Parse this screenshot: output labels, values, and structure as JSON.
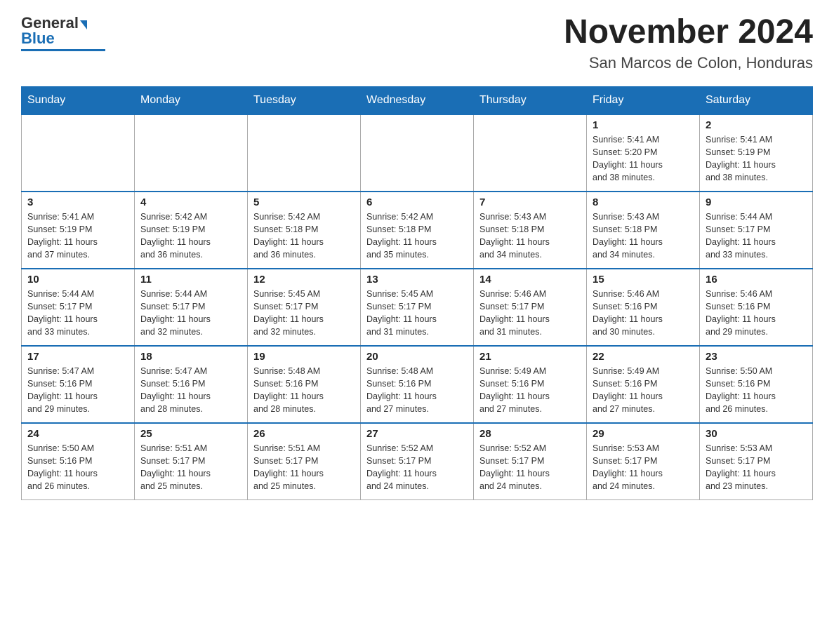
{
  "logo": {
    "general": "General",
    "blue": "Blue"
  },
  "title": "November 2024",
  "location": "San Marcos de Colon, Honduras",
  "weekdays": [
    "Sunday",
    "Monday",
    "Tuesday",
    "Wednesday",
    "Thursday",
    "Friday",
    "Saturday"
  ],
  "weeks": [
    [
      {
        "day": "",
        "info": ""
      },
      {
        "day": "",
        "info": ""
      },
      {
        "day": "",
        "info": ""
      },
      {
        "day": "",
        "info": ""
      },
      {
        "day": "",
        "info": ""
      },
      {
        "day": "1",
        "info": "Sunrise: 5:41 AM\nSunset: 5:20 PM\nDaylight: 11 hours\nand 38 minutes."
      },
      {
        "day": "2",
        "info": "Sunrise: 5:41 AM\nSunset: 5:19 PM\nDaylight: 11 hours\nand 38 minutes."
      }
    ],
    [
      {
        "day": "3",
        "info": "Sunrise: 5:41 AM\nSunset: 5:19 PM\nDaylight: 11 hours\nand 37 minutes."
      },
      {
        "day": "4",
        "info": "Sunrise: 5:42 AM\nSunset: 5:19 PM\nDaylight: 11 hours\nand 36 minutes."
      },
      {
        "day": "5",
        "info": "Sunrise: 5:42 AM\nSunset: 5:18 PM\nDaylight: 11 hours\nand 36 minutes."
      },
      {
        "day": "6",
        "info": "Sunrise: 5:42 AM\nSunset: 5:18 PM\nDaylight: 11 hours\nand 35 minutes."
      },
      {
        "day": "7",
        "info": "Sunrise: 5:43 AM\nSunset: 5:18 PM\nDaylight: 11 hours\nand 34 minutes."
      },
      {
        "day": "8",
        "info": "Sunrise: 5:43 AM\nSunset: 5:18 PM\nDaylight: 11 hours\nand 34 minutes."
      },
      {
        "day": "9",
        "info": "Sunrise: 5:44 AM\nSunset: 5:17 PM\nDaylight: 11 hours\nand 33 minutes."
      }
    ],
    [
      {
        "day": "10",
        "info": "Sunrise: 5:44 AM\nSunset: 5:17 PM\nDaylight: 11 hours\nand 33 minutes."
      },
      {
        "day": "11",
        "info": "Sunrise: 5:44 AM\nSunset: 5:17 PM\nDaylight: 11 hours\nand 32 minutes."
      },
      {
        "day": "12",
        "info": "Sunrise: 5:45 AM\nSunset: 5:17 PM\nDaylight: 11 hours\nand 32 minutes."
      },
      {
        "day": "13",
        "info": "Sunrise: 5:45 AM\nSunset: 5:17 PM\nDaylight: 11 hours\nand 31 minutes."
      },
      {
        "day": "14",
        "info": "Sunrise: 5:46 AM\nSunset: 5:17 PM\nDaylight: 11 hours\nand 31 minutes."
      },
      {
        "day": "15",
        "info": "Sunrise: 5:46 AM\nSunset: 5:16 PM\nDaylight: 11 hours\nand 30 minutes."
      },
      {
        "day": "16",
        "info": "Sunrise: 5:46 AM\nSunset: 5:16 PM\nDaylight: 11 hours\nand 29 minutes."
      }
    ],
    [
      {
        "day": "17",
        "info": "Sunrise: 5:47 AM\nSunset: 5:16 PM\nDaylight: 11 hours\nand 29 minutes."
      },
      {
        "day": "18",
        "info": "Sunrise: 5:47 AM\nSunset: 5:16 PM\nDaylight: 11 hours\nand 28 minutes."
      },
      {
        "day": "19",
        "info": "Sunrise: 5:48 AM\nSunset: 5:16 PM\nDaylight: 11 hours\nand 28 minutes."
      },
      {
        "day": "20",
        "info": "Sunrise: 5:48 AM\nSunset: 5:16 PM\nDaylight: 11 hours\nand 27 minutes."
      },
      {
        "day": "21",
        "info": "Sunrise: 5:49 AM\nSunset: 5:16 PM\nDaylight: 11 hours\nand 27 minutes."
      },
      {
        "day": "22",
        "info": "Sunrise: 5:49 AM\nSunset: 5:16 PM\nDaylight: 11 hours\nand 27 minutes."
      },
      {
        "day": "23",
        "info": "Sunrise: 5:50 AM\nSunset: 5:16 PM\nDaylight: 11 hours\nand 26 minutes."
      }
    ],
    [
      {
        "day": "24",
        "info": "Sunrise: 5:50 AM\nSunset: 5:16 PM\nDaylight: 11 hours\nand 26 minutes."
      },
      {
        "day": "25",
        "info": "Sunrise: 5:51 AM\nSunset: 5:17 PM\nDaylight: 11 hours\nand 25 minutes."
      },
      {
        "day": "26",
        "info": "Sunrise: 5:51 AM\nSunset: 5:17 PM\nDaylight: 11 hours\nand 25 minutes."
      },
      {
        "day": "27",
        "info": "Sunrise: 5:52 AM\nSunset: 5:17 PM\nDaylight: 11 hours\nand 24 minutes."
      },
      {
        "day": "28",
        "info": "Sunrise: 5:52 AM\nSunset: 5:17 PM\nDaylight: 11 hours\nand 24 minutes."
      },
      {
        "day": "29",
        "info": "Sunrise: 5:53 AM\nSunset: 5:17 PM\nDaylight: 11 hours\nand 24 minutes."
      },
      {
        "day": "30",
        "info": "Sunrise: 5:53 AM\nSunset: 5:17 PM\nDaylight: 11 hours\nand 23 minutes."
      }
    ]
  ]
}
